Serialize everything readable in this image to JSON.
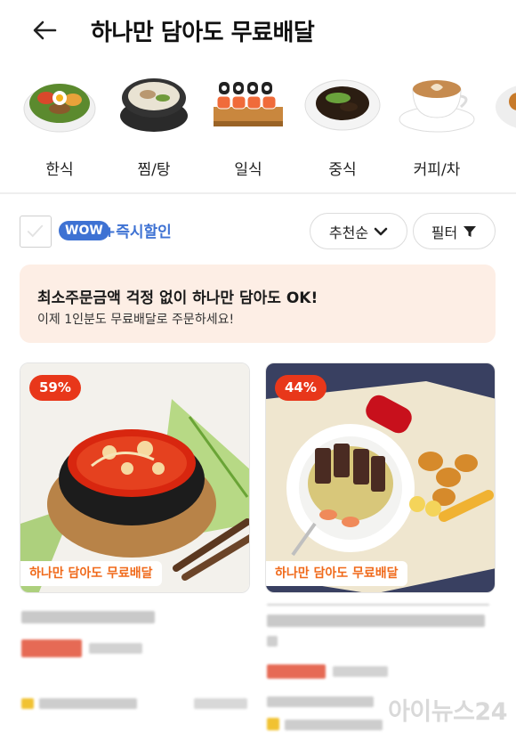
{
  "header": {
    "title": "하나만 담아도 무료배달"
  },
  "categories": [
    {
      "label": "한식",
      "icon": "bibimbap-icon"
    },
    {
      "label": "찜/탕",
      "icon": "stew-pot-icon"
    },
    {
      "label": "일식",
      "icon": "sushi-icon"
    },
    {
      "label": "중식",
      "icon": "jajangmyeon-icon"
    },
    {
      "label": "커피/차",
      "icon": "latte-cup-icon"
    }
  ],
  "filters": {
    "wow_badge": "WOW",
    "instant_discount": "+즉시할인",
    "sort_label": "추천순",
    "filter_label": "필터"
  },
  "banner": {
    "headline": "최소주문금액 걱정 없이 하나만 담아도 OK!",
    "subtext": "이제 1인분도 무료배달로 주문하세요!"
  },
  "cards": [
    {
      "discount": "59%",
      "tag": "하나만 담아도 무료배달"
    },
    {
      "discount": "44%",
      "tag": "하나만 담아도 무료배달"
    }
  ],
  "watermark": "아이뉴스24",
  "colors": {
    "accent_blue": "#3e72d3",
    "discount_red": "#e8371a",
    "tag_orange": "#f06a1b",
    "banner_bg": "#fdeee5"
  }
}
